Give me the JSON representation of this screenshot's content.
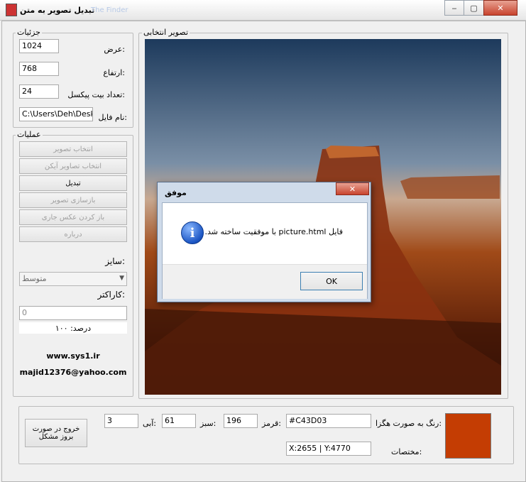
{
  "window": {
    "title": "تبدیل تصویر به متن",
    "ghost_text": "The Finder",
    "minimize": "‒",
    "maximize": "▢",
    "close": "✕"
  },
  "details": {
    "group_label": "جزئیات",
    "width_label": "عرض:",
    "width_value": "1024",
    "height_label": "ارتفاع:",
    "height_value": "768",
    "bpp_label": "تعداد بیت پیکسل:",
    "bpp_value": "24",
    "filename_label": "نام فایل:",
    "filename_value": "C:\\Users\\Deh\\Deskto"
  },
  "operations": {
    "group_label": "عملیات",
    "buttons": [
      "انتخاب تصویر",
      "انتخاب تصاویر آیکن",
      "تبدیل",
      "بازسازی تصویر",
      "باز کردن عکس جاری",
      "درباره"
    ],
    "size_label": "سایز:",
    "size_value": "متوسط",
    "char_label": "کاراکتر:",
    "char_value": "0",
    "percent_label": "درصد: ۱۰۰",
    "site": "www.sys1.ir",
    "email": "majid12376@yahoo.com"
  },
  "image_panel": {
    "group_label": "تصویر انتخابی"
  },
  "bottom": {
    "exit_button_line1": "خروج در صورت",
    "exit_button_line2": "بروز مشکل",
    "blue_label": "آبی:",
    "blue_value": "3",
    "green_label": "سبز:",
    "green_value": "61",
    "red_label": "قرمز:",
    "red_value": "196",
    "hex_label": "رنگ به صورت هگزا:",
    "hex_value": "#C43D03",
    "coords_label": "مختصات:",
    "coords_value": "X:2655 | Y:4770",
    "swatch_color": "#C43D03"
  },
  "dialog": {
    "title": "موفق",
    "message": "فایل picture.html با موفقیت ساخته شد.",
    "ok_label": "OK",
    "icon": "info-icon",
    "close": "✕"
  }
}
